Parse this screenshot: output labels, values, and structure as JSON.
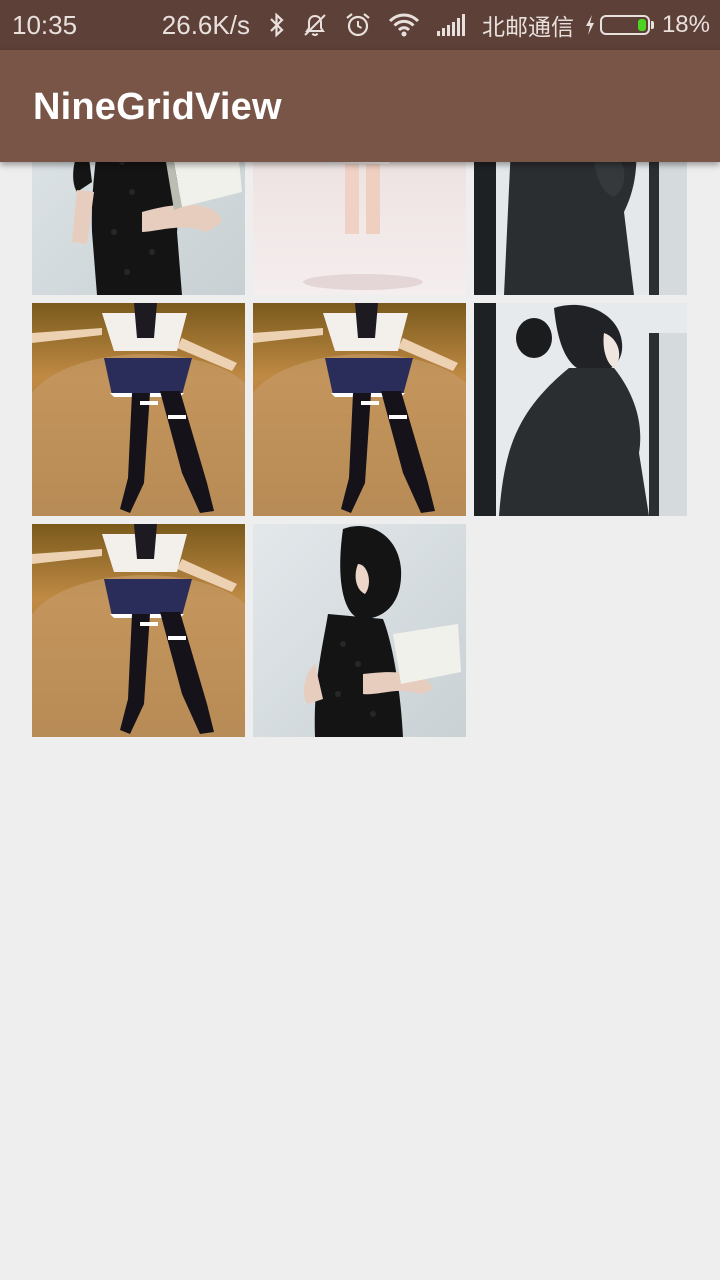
{
  "status_bar": {
    "time": "10:35",
    "net_speed": "26.6K/s",
    "carrier": "北邮通信",
    "battery": "18%",
    "battery_level": 0.18,
    "icons": [
      "bluetooth-icon",
      "notifications-off-icon",
      "alarm-icon",
      "wifi-icon",
      "signal-icon",
      "charging-icon",
      "battery-icon"
    ]
  },
  "app_bar": {
    "title": "NineGridView"
  },
  "grid": {
    "images": [
      {
        "subject": "woman-black-lace-dress-reading"
      },
      {
        "subject": "woman-white-dress-walking"
      },
      {
        "subject": "woman-dark-sweater-by-window"
      },
      {
        "subject": "girl-sailor-uniform-on-bed"
      },
      {
        "subject": "girl-sailor-uniform-on-bed"
      },
      {
        "subject": "woman-dark-sweater-by-window"
      },
      {
        "subject": "girl-sailor-uniform-on-bed"
      },
      {
        "subject": "woman-black-lace-dress-reading"
      }
    ]
  },
  "colors": {
    "status_bar": "#5d4037",
    "app_bar": "#795548",
    "background": "#eeeeee",
    "battery_fill": "#4cd421"
  }
}
